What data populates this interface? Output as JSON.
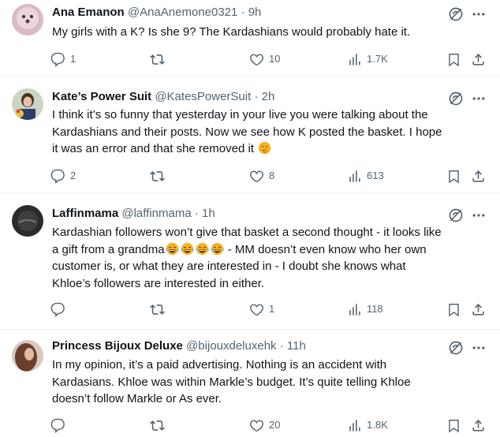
{
  "colors": {
    "text": "#0f1419",
    "secondary": "#536471",
    "divider": "#eff3f4",
    "emoji": "#f7b125"
  },
  "replies": [
    {
      "name": "Ana Emanon",
      "handle": "@AnaAnemone0321",
      "dot": "·",
      "time": "9h",
      "text": "My girls with a K?  Is she 9? The Kardashians would probably hate it.",
      "reply_count": "1",
      "retweet_count": "",
      "like_count": "10",
      "view_count": "1.7K"
    },
    {
      "name": "Kate’s Power Suit",
      "handle": "@KatesPowerSuit",
      "dot": "·",
      "time": "2h",
      "text_lines": [
        "I think it’s so funny that yesterday in your live you were talking about the",
        "Kardashians and their posts. Now we see how K posted the basket. I hope",
        "it was an error and that she removed it"
      ],
      "reply_count": "2",
      "retweet_count": "",
      "like_count": "8",
      "view_count": "613"
    },
    {
      "name": "Laffinmama",
      "handle": "@laffinmama",
      "dot": "·",
      "time": "1h",
      "text_lines": [
        "Kardashian followers won’t give that basket a second thought - it looks like",
        "a gift from a grandma",
        " - MM doesn’t even know who her own",
        "customer is, or what they are interested in - I doubt she knows what",
        "Khloe’s followers are interested in either."
      ],
      "reply_count": "",
      "retweet_count": "",
      "like_count": "1",
      "view_count": "118"
    },
    {
      "name": "Princess Bijoux Deluxe",
      "handle": "@bijouxdeluxehk",
      "dot": "·",
      "time": "11h",
      "text_lines": [
        "In my opinion, it’s a paid advertising. Nothing is an accident with",
        "Kardasians. Khloe was within Markle’s budget. It’s quite telling Khloe",
        "doesn’t follow Markle or As ever."
      ],
      "reply_count": "",
      "retweet_count": "",
      "like_count": "20",
      "view_count": "1.8K"
    }
  ]
}
